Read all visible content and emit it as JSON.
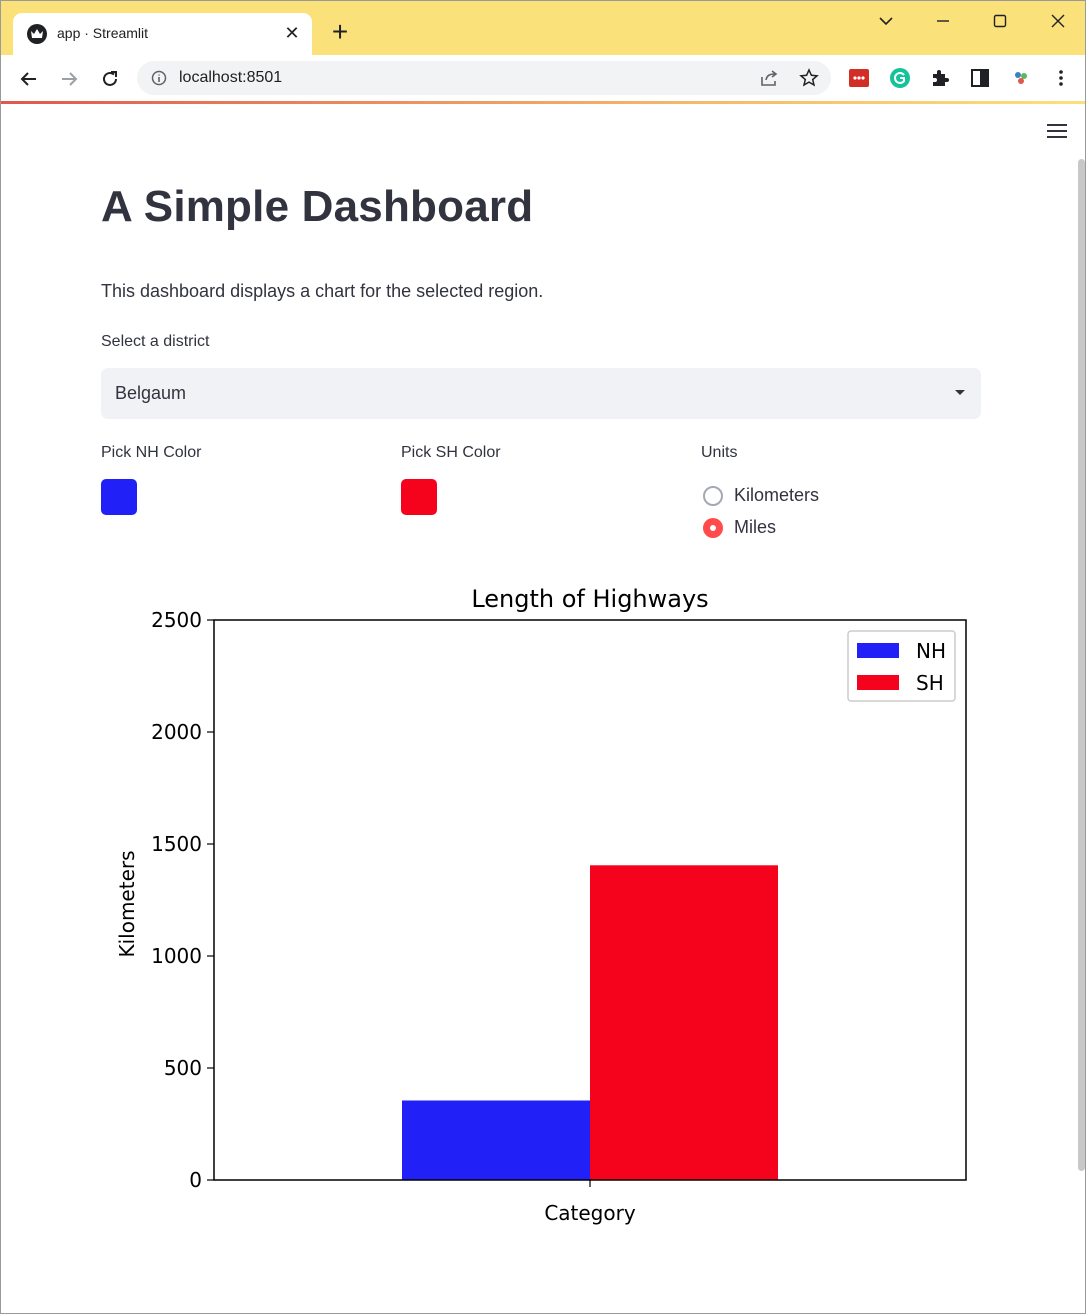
{
  "browser": {
    "tab_title": "app · Streamlit",
    "tab_close": "✕",
    "new_tab": "+",
    "url": "localhost:8501"
  },
  "page": {
    "title": "A Simple Dashboard",
    "description": "This dashboard displays a chart for the selected region.",
    "district_select": {
      "label": "Select a district",
      "value": "Belgaum"
    },
    "nh_color": {
      "label": "Pick NH Color",
      "value": "#2121f7"
    },
    "sh_color": {
      "label": "Pick SH Color",
      "value": "#f5031c"
    },
    "units": {
      "label": "Units",
      "options": [
        "Kilometers",
        "Miles"
      ],
      "selected": "Miles"
    }
  },
  "colors": {
    "accent": "#ff4b4b",
    "text": "#31333f",
    "tabstrip": "#fbe17a"
  },
  "chart_data": {
    "type": "bar",
    "title": "Length of Highways",
    "xlabel": "Category",
    "ylabel": "Kilometers",
    "ylim": [
      0,
      2500
    ],
    "yticks": [
      0,
      500,
      1000,
      1500,
      2000,
      2500
    ],
    "categories": [
      ""
    ],
    "legend_position": "top-right",
    "series": [
      {
        "name": "NH",
        "color": "#2121f7",
        "values": [
          355
        ]
      },
      {
        "name": "SH",
        "color": "#f5031c",
        "values": [
          1405
        ]
      }
    ]
  }
}
